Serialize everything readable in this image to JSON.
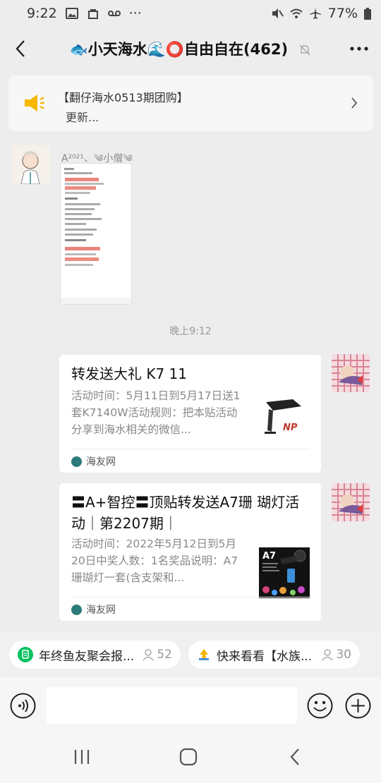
{
  "status_bar": {
    "time": "9:22",
    "dots": "···",
    "battery": "77%"
  },
  "header": {
    "title": "🐟小天海水🌊⭕自由自在(462)"
  },
  "notice": {
    "title": "【翻仔海水0513期团购】",
    "subtitle": "更新..."
  },
  "messages": {
    "image_message": {
      "sender": "A²⁰²¹、༄小僧༄"
    },
    "time_divider": "晚上9:12",
    "card1": {
      "title": "转发送大礼 K7 11",
      "desc": "活动时间：5月11日到5月17日送1套K7140W活动规则：把本贴活动分享到海水相关的微信...",
      "source": "海友网",
      "thumb_label": "NP"
    },
    "card2": {
      "title": "〓A+智控〓顶贴转发送A7珊 瑚灯活动｜第2207期｜",
      "desc": "活动时间：2022年5月12日到5月20日中奖人数：1名奖品说明：A7珊瑚灯一套(含支架和...",
      "source": "海友网",
      "thumb_label": "A7"
    }
  },
  "quick_bar": [
    {
      "label": "年终鱼友聚会报...",
      "count": "52"
    },
    {
      "label": "快来看看【水族...",
      "count": "30"
    }
  ],
  "colors": {
    "background": "#ededed",
    "notice_icon": "#f5b700",
    "chip_green": "#07c160"
  }
}
